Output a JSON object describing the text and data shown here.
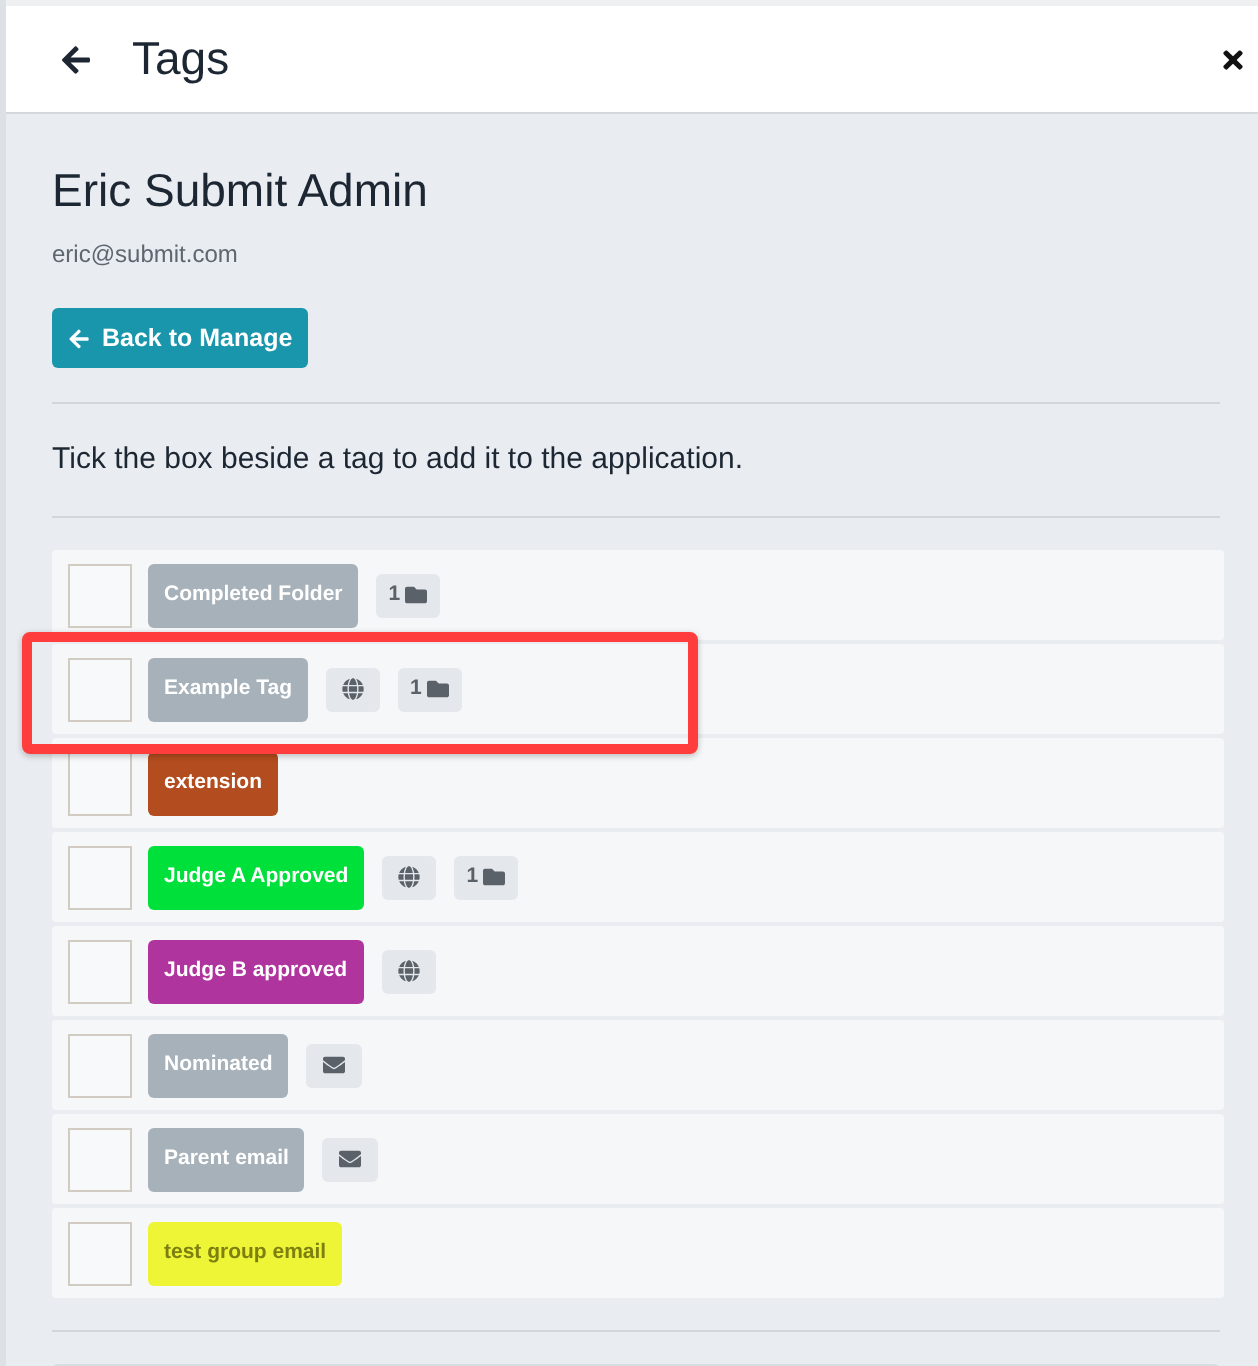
{
  "header": {
    "title": "Tags"
  },
  "user": {
    "name": "Eric Submit Admin",
    "email": "eric@submit.com"
  },
  "back_button": {
    "label": "Back to Manage"
  },
  "instructions": "Tick the box beside a tag to add it to the application.",
  "tags": [
    {
      "label": "Completed Folder",
      "color": "#a7b1b9",
      "checked": false,
      "highlighted": false,
      "indicators": [
        {
          "kind": "folder",
          "count": "1"
        }
      ]
    },
    {
      "label": "Example Tag",
      "color": "#a7b1b9",
      "checked": false,
      "highlighted": true,
      "indicators": [
        {
          "kind": "global"
        },
        {
          "kind": "folder",
          "count": "1"
        }
      ]
    },
    {
      "label": "extension",
      "color": "#b34d1f",
      "checked": false,
      "highlighted": false
    },
    {
      "label": "Judge A Approved",
      "color": "#00e03a",
      "checked": false,
      "highlighted": false,
      "indicators": [
        {
          "kind": "global"
        },
        {
          "kind": "folder",
          "count": "1"
        }
      ]
    },
    {
      "label": "Judge B approved",
      "color": "#b0349e",
      "checked": false,
      "highlighted": false,
      "indicators": [
        {
          "kind": "global"
        }
      ]
    },
    {
      "label": "Nominated",
      "color": "#a7b1b9",
      "checked": false,
      "highlighted": false,
      "indicators": [
        {
          "kind": "email"
        }
      ]
    },
    {
      "label": "Parent email",
      "color": "#a7b1b9",
      "checked": false,
      "highlighted": false,
      "indicators": [
        {
          "kind": "email"
        }
      ]
    },
    {
      "label": "test group email",
      "color": "#eef536",
      "checked": false,
      "highlighted": false
    }
  ]
}
